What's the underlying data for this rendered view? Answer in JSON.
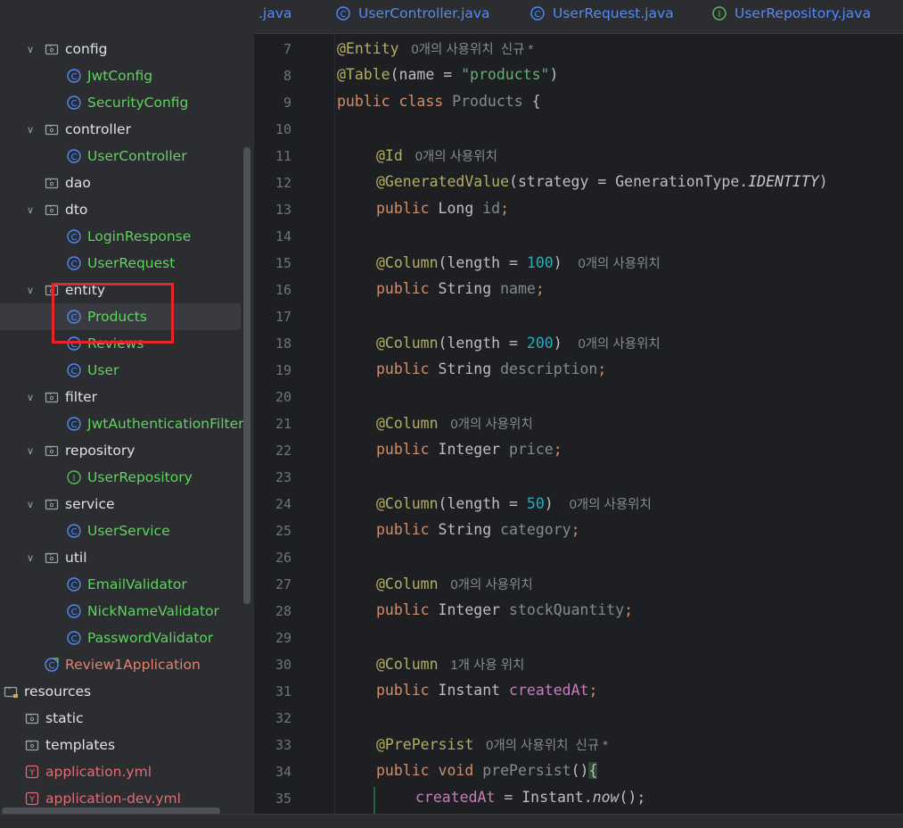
{
  "tabs": [
    {
      "label": ".java",
      "icon": "class-icon"
    },
    {
      "label": "UserController.java",
      "icon": "class-icon"
    },
    {
      "label": "UserRequest.java",
      "icon": "class-icon"
    },
    {
      "label": "UserRepository.java",
      "icon": "interface-icon"
    }
  ],
  "tree": [
    {
      "label": "config",
      "type": "folder",
      "expanded": true
    },
    {
      "label": "JwtConfig",
      "type": "class"
    },
    {
      "label": "SecurityConfig",
      "type": "class"
    },
    {
      "label": "controller",
      "type": "folder",
      "expanded": true
    },
    {
      "label": "UserController",
      "type": "class"
    },
    {
      "label": "dao",
      "type": "folder"
    },
    {
      "label": "dto",
      "type": "folder",
      "expanded": true
    },
    {
      "label": "LoginResponse",
      "type": "class"
    },
    {
      "label": "UserRequest",
      "type": "class"
    },
    {
      "label": "entity",
      "type": "folder",
      "expanded": true
    },
    {
      "label": "Products",
      "type": "class",
      "selected": true
    },
    {
      "label": "Reviews",
      "type": "class"
    },
    {
      "label": "User",
      "type": "class"
    },
    {
      "label": "filter",
      "type": "folder",
      "expanded": true
    },
    {
      "label": "JwtAuthenticationFilter",
      "type": "class"
    },
    {
      "label": "repository",
      "type": "folder",
      "expanded": true
    },
    {
      "label": "UserRepository",
      "type": "interface"
    },
    {
      "label": "service",
      "type": "folder",
      "expanded": true
    },
    {
      "label": "UserService",
      "type": "class"
    },
    {
      "label": "util",
      "type": "folder",
      "expanded": true
    },
    {
      "label": "EmailValidator",
      "type": "class"
    },
    {
      "label": "NickNameValidator",
      "type": "class"
    },
    {
      "label": "PasswordValidator",
      "type": "class"
    },
    {
      "label": "Review1Application",
      "type": "app"
    },
    {
      "label": "resources",
      "type": "resources-folder"
    },
    {
      "label": "static",
      "type": "folder"
    },
    {
      "label": "templates",
      "type": "folder"
    },
    {
      "label": "application.yml",
      "type": "yml"
    },
    {
      "label": "application-dev.yml",
      "type": "yml"
    }
  ],
  "code": {
    "line_numbers": [
      "7",
      "8",
      "9",
      "10",
      "11",
      "12",
      "13",
      "14",
      "15",
      "16",
      "17",
      "18",
      "19",
      "20",
      "21",
      "22",
      "23",
      "24",
      "25",
      "26",
      "27",
      "28",
      "29",
      "30",
      "31",
      "32",
      "33",
      "34",
      "35"
    ],
    "hints": {
      "usages0_new": "0개의 사용위치  신규 *",
      "usages0": "0개의 사용위치",
      "usages1": "1개 사용 위치"
    },
    "tokens": {
      "entity": "@Entity",
      "table": "@Table",
      "table_args": "(name = ",
      "table_str": "\"products\"",
      "close_paren": ")",
      "public": "public",
      "class": "class",
      "class_name": "Products",
      "open_brace": "{",
      "id_ann": "@Id",
      "gen_ann": "@GeneratedValue",
      "gen_args": "(strategy = GenerationType.",
      "identity": "IDENTITY",
      "long_type": "Long",
      "id_field": "id",
      "semi": ";",
      "column": "@Column",
      "length_args": "(length = ",
      "len100": "100",
      "len200": "200",
      "len50": "50",
      "string_type": "String",
      "integer_type": "Integer",
      "instant_type": "Instant",
      "f_name": "name",
      "f_description": "description",
      "f_price": "price",
      "f_category": "category",
      "f_stock": "stockQuantity",
      "f_created": "createdAt",
      "prepersist_ann": "@PrePersist",
      "void": "void",
      "prepersist_method": "prePersist",
      "method_parens": "()",
      "assign": " = Instant.",
      "now": "now",
      "call_end": "();"
    }
  }
}
